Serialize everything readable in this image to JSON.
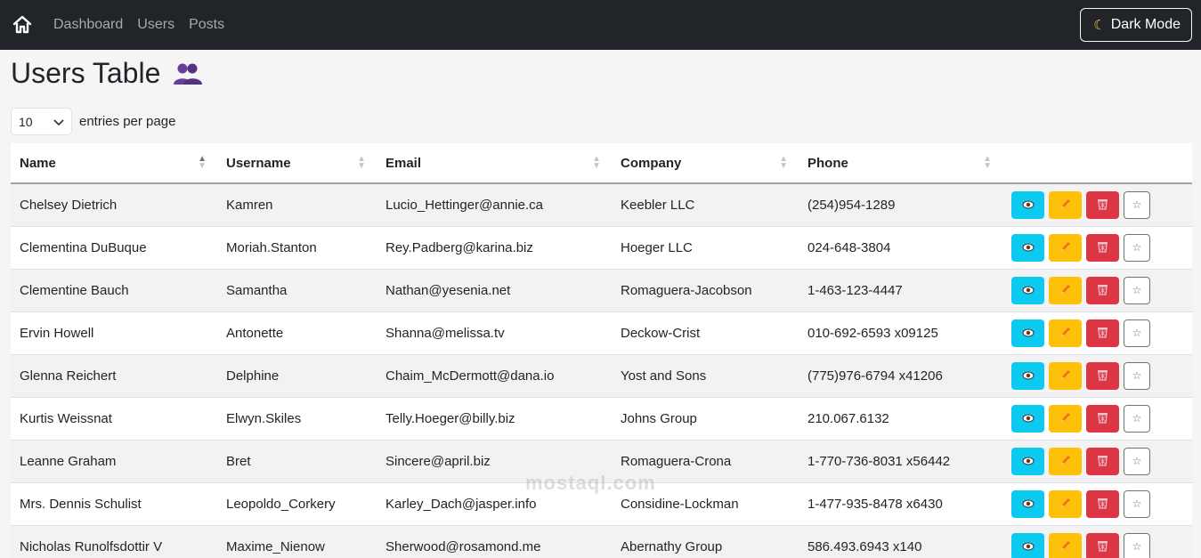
{
  "navbar": {
    "links": [
      "Dashboard",
      "Users",
      "Posts"
    ],
    "dark_mode_label": "Dark Mode"
  },
  "page": {
    "title": "Users Table",
    "entries_value": "10",
    "entries_label": "entries per page"
  },
  "table": {
    "headers": [
      "Name",
      "Username",
      "Email",
      "Company",
      "Phone"
    ],
    "rows": [
      [
        "Chelsey Dietrich",
        "Kamren",
        "Lucio_Hettinger@annie.ca",
        "Keebler LLC",
        "(254)954-1289"
      ],
      [
        "Clementina DuBuque",
        "Moriah.Stanton",
        "Rey.Padberg@karina.biz",
        "Hoeger LLC",
        "024-648-3804"
      ],
      [
        "Clementine Bauch",
        "Samantha",
        "Nathan@yesenia.net",
        "Romaguera-Jacobson",
        "1-463-123-4447"
      ],
      [
        "Ervin Howell",
        "Antonette",
        "Shanna@melissa.tv",
        "Deckow-Crist",
        "010-692-6593 x09125"
      ],
      [
        "Glenna Reichert",
        "Delphine",
        "Chaim_McDermott@dana.io",
        "Yost and Sons",
        "(775)976-6794 x41206"
      ],
      [
        "Kurtis Weissnat",
        "Elwyn.Skiles",
        "Telly.Hoeger@billy.biz",
        "Johns Group",
        "210.067.6132"
      ],
      [
        "Leanne Graham",
        "Bret",
        "Sincere@april.biz",
        "Romaguera-Crona",
        "1-770-736-8031 x56442"
      ],
      [
        "Mrs. Dennis Schulist",
        "Leopoldo_Corkery",
        "Karley_Dach@jasper.info",
        "Considine-Lockman",
        "1-477-935-8478 x6430"
      ],
      [
        "Nicholas Runolfsdottir V",
        "Maxime_Nienow",
        "Sherwood@rosamond.me",
        "Abernathy Group",
        "586.493.6943 x140"
      ]
    ],
    "action_icons": [
      "eye-icon",
      "pencil-icon",
      "trash-icon",
      "star-icon"
    ]
  },
  "watermark": "mostaql.com",
  "colors": {
    "navbar": "#212529",
    "view": "#0dcaf0",
    "edit": "#ffc107",
    "delete": "#dc3545"
  }
}
